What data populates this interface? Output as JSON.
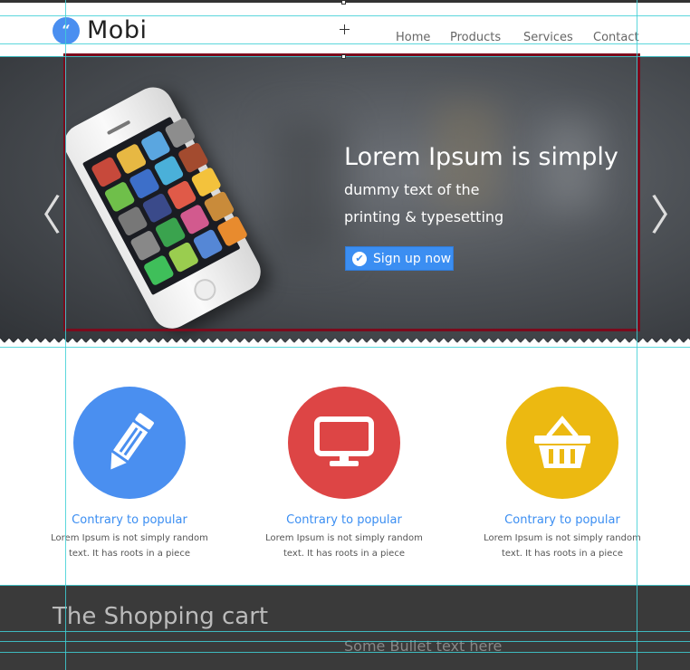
{
  "header": {
    "logo_glyph": "“",
    "logo_text": "Mobi",
    "nav": [
      {
        "label": "Home"
      },
      {
        "label": "Products"
      },
      {
        "label": "Services"
      },
      {
        "label": "Contact"
      }
    ]
  },
  "hero": {
    "prev_arrow": "〈",
    "next_arrow": "〉",
    "title": "Lorem Ipsum is simply",
    "subtitle_line1": "dummy text of the",
    "subtitle_line2": "printing & typesetting",
    "cta_label": "Sign up now",
    "cta_icon": "✔"
  },
  "features": [
    {
      "icon": "pencil-icon",
      "color": "#4a8ff0",
      "title": "Contrary to popular",
      "line1": "Lorem Ipsum is not simply random",
      "line2": "text. It has roots in a piece"
    },
    {
      "icon": "monitor-icon",
      "color": "#dd4545",
      "title": "Contrary to popular",
      "line1": "Lorem Ipsum is not simply random",
      "line2": "text. It has roots in a piece"
    },
    {
      "icon": "basket-icon",
      "color": "#ecb911",
      "title": "Contrary to popular",
      "line1": "Lorem Ipsum is not simply random",
      "line2": "text. It has roots in a piece"
    }
  ],
  "cart": {
    "title": "The Shopping cart",
    "bullet": "Some Bullet text here"
  },
  "colors": {
    "accent": "#3b8ef2",
    "selection": "#7b0a1c",
    "guides": "#3fd0d6"
  }
}
